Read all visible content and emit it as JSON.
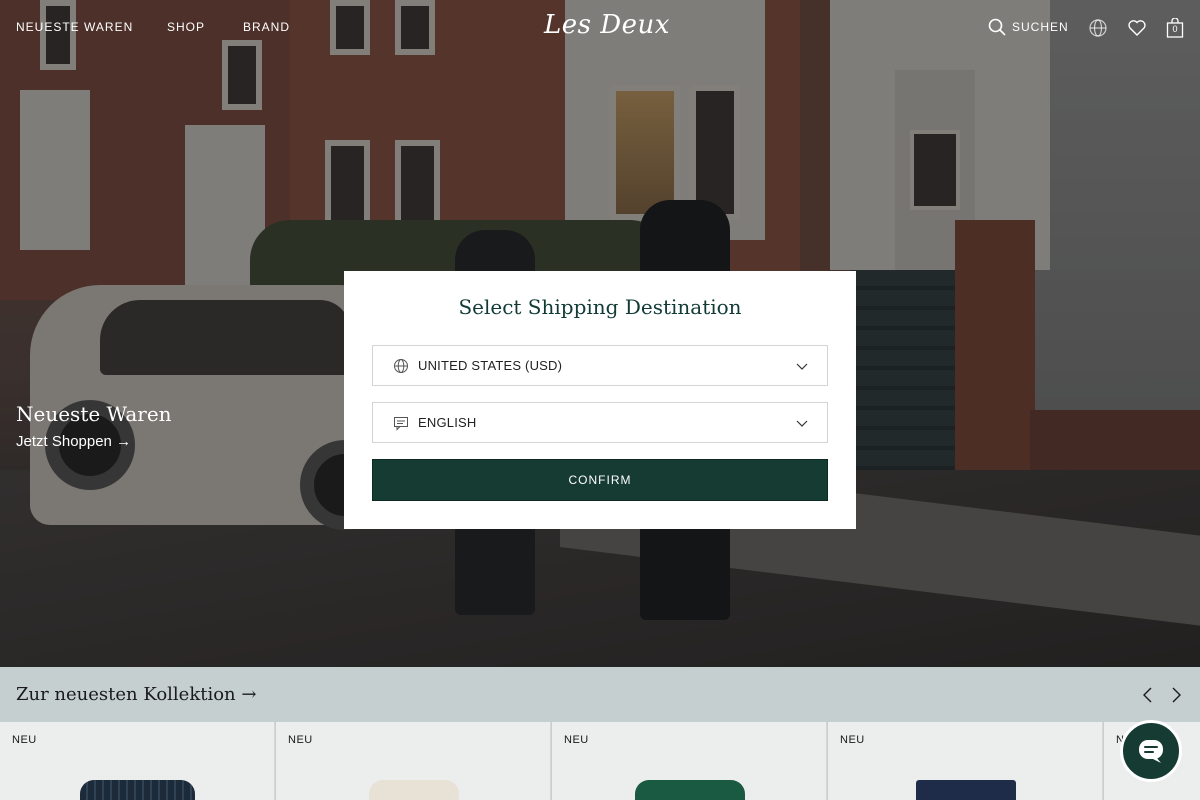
{
  "header": {
    "nav": [
      "NEUESTE WAREN",
      "SHOP",
      "BRAND"
    ],
    "logo_text": "Les Deux",
    "search_label": "SUCHEN",
    "cart_count": "0"
  },
  "hero": {
    "title": "Neueste Waren",
    "cta": "Jetzt Shoppen →"
  },
  "modal": {
    "title": "Select Shipping Destination",
    "country_value": "UNITED STATES (USD)",
    "language_value": "ENGLISH",
    "confirm_label": "CONFIRM"
  },
  "collection": {
    "title": "Zur neuesten Kollektion →",
    "cards": [
      {
        "badge": "NEU"
      },
      {
        "badge": "NEU"
      },
      {
        "badge": "NEU"
      },
      {
        "badge": "NEU"
      },
      {
        "badge": "NEU"
      }
    ]
  },
  "colors": {
    "brand_green": "#163b33",
    "collection_bar": "#c5cfd0"
  }
}
